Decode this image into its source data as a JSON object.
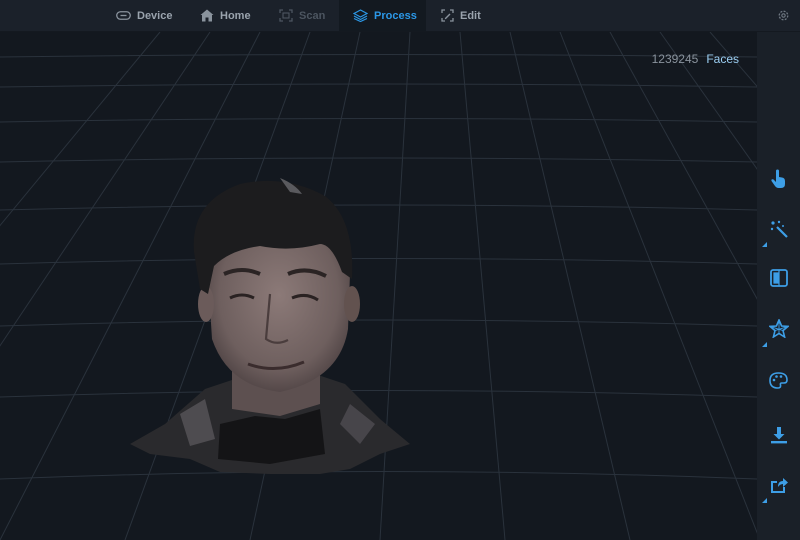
{
  "nav": {
    "tabs": [
      {
        "label": "Device",
        "icon": "link-icon",
        "state": "normal"
      },
      {
        "label": "Home",
        "icon": "home-icon",
        "state": "normal"
      },
      {
        "label": "Scan",
        "icon": "scan-icon",
        "state": "disabled"
      },
      {
        "label": "Process",
        "icon": "layers-icon",
        "state": "active"
      },
      {
        "label": "Edit",
        "icon": "edit-icon",
        "state": "normal"
      }
    ],
    "settings_icon": "gear-icon"
  },
  "viewport": {
    "face_count": "1239245",
    "face_label": "Faces",
    "model": "scanned-head-mesh"
  },
  "sidebar": {
    "tools": [
      {
        "icon": "touch-icon",
        "has_submenu": false
      },
      {
        "icon": "magic-wand-icon",
        "has_submenu": true
      },
      {
        "icon": "flip-icon",
        "has_submenu": false
      },
      {
        "icon": "mesh-star-icon",
        "has_submenu": true
      },
      {
        "icon": "palette-icon",
        "has_submenu": false
      },
      {
        "icon": "download-icon",
        "has_submenu": false
      },
      {
        "icon": "share-icon",
        "has_submenu": true
      }
    ]
  },
  "colors": {
    "accent": "#2b97e6",
    "background": "#13181f",
    "topbar": "#1b212a",
    "sidebar": "#1a2028"
  }
}
